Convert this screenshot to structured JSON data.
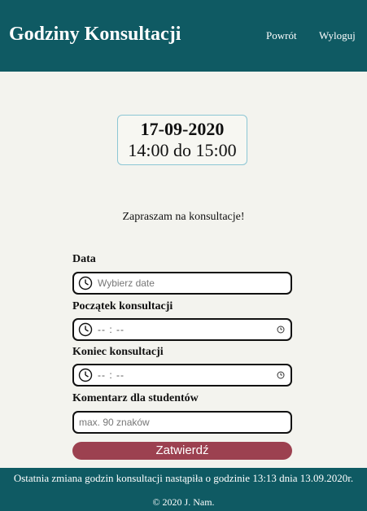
{
  "header": {
    "title": "Godziny Konsultacji",
    "nav": [
      "Powrót",
      "Wyloguj"
    ]
  },
  "consultation": {
    "date": "17-09-2020",
    "hours": "14:00 do 15:00"
  },
  "invite_text": "Zapraszam na konsultacje!",
  "form": {
    "date_label": "Data",
    "date_placeholder": "Wybierz date",
    "start_label": "Początek konsultacji",
    "start_value": "-- : --",
    "end_label": "Koniec konsultacji",
    "end_value": "-- : --",
    "comment_label": "Komentarz dla studentów",
    "comment_placeholder": "max. 90 znaków",
    "submit_label": "Zatwierdź"
  },
  "footer": {
    "note": "Ostatnia zmiana godzin konsultacji nastąpiła o godzinie 13:13 dnia 13.09.2020r.",
    "copyright": "© 2020 J. Nam."
  },
  "colors": {
    "header": "#0f5a63",
    "submit": "#9c4150",
    "background": "#f3f3ee"
  }
}
